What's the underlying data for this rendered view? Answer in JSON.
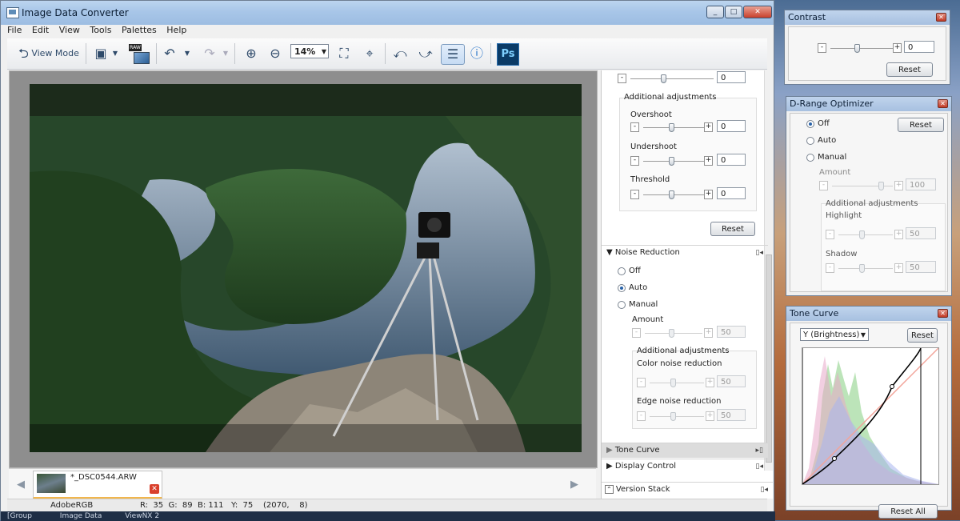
{
  "main_window": {
    "title": "Image Data Converter",
    "window_buttons": [
      "_",
      "□",
      "✕"
    ]
  },
  "menu": [
    "File",
    "Edit",
    "View",
    "Tools",
    "Palettes",
    "Help"
  ],
  "toolbar": {
    "view_mode_label": "View Mode",
    "raw_badge": "RAW",
    "zoom_value": "14%",
    "ps_label": "Ps"
  },
  "filmstrip": {
    "filename": "*_DSC0544.ARW"
  },
  "status": {
    "color_space": "AdobeRGB",
    "pixel_info": "R:  35  G:  89  B: 111   Y:  75    (2070,    8)"
  },
  "taskbar": {
    "items": [
      "[Group",
      "Image Data",
      "ViewNX 2"
    ]
  },
  "right_panel": {
    "top_slider_value": "0",
    "additional_adjustments": "Additional adjustments",
    "overshoot": {
      "label": "Overshoot",
      "value": "0"
    },
    "undershoot": {
      "label": "Undershoot",
      "value": "0"
    },
    "threshold": {
      "label": "Threshold",
      "value": "0"
    },
    "reset": "Reset",
    "noise_reduction": {
      "header": "Noise Reduction",
      "options": [
        "Off",
        "Auto",
        "Manual"
      ],
      "selected": "Auto",
      "amount_label": "Amount",
      "amount_value": "50",
      "additional": "Additional adjustments",
      "color_label": "Color noise reduction",
      "color_value": "50",
      "edge_label": "Edge noise reduction",
      "edge_value": "50"
    },
    "tone_curve_header": "Tone Curve",
    "display_control_header": "Display Control",
    "version_stack_header": "Version Stack"
  },
  "contrast_window": {
    "title": "Contrast",
    "value": "0",
    "reset": "Reset"
  },
  "drange_window": {
    "title": "D-Range Optimizer",
    "options": [
      "Off",
      "Auto",
      "Manual"
    ],
    "selected": "Off",
    "reset": "Reset",
    "amount_label": "Amount",
    "amount_value": "100",
    "additional": "Additional adjustments",
    "highlight_label": "Highlight",
    "highlight_value": "50",
    "shadow_label": "Shadow",
    "shadow_value": "50"
  },
  "tone_curve_window": {
    "title": "Tone Curve",
    "channel": "Y (Brightness)",
    "reset": "Reset",
    "reset_all": "Reset All"
  }
}
